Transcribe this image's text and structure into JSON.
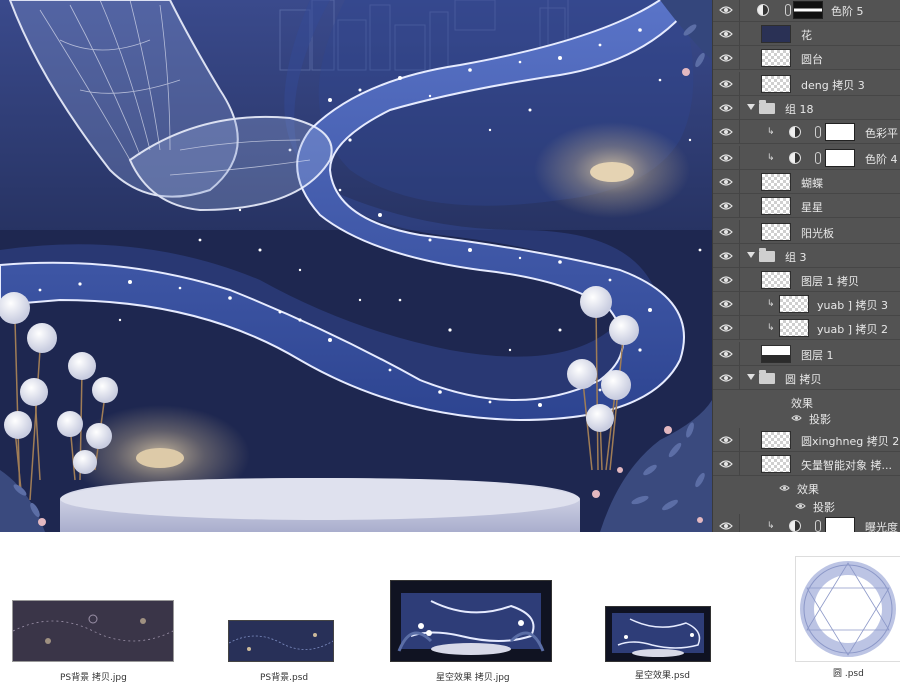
{
  "layers": [
    {
      "name": "色阶 5",
      "kind": "adjust",
      "visible": true
    },
    {
      "name": "花",
      "kind": "layer",
      "thumb": "dark",
      "visible": true
    },
    {
      "name": "圆台",
      "kind": "layer",
      "visible": true
    },
    {
      "name": "deng 拷贝 3",
      "kind": "layer",
      "visible": true
    },
    {
      "name": "组 18",
      "kind": "group",
      "visible": true
    },
    {
      "name": "色彩平",
      "kind": "adjust-clip",
      "visible": true
    },
    {
      "name": "色阶 4",
      "kind": "adjust-clip",
      "visible": true
    },
    {
      "name": "蝴蝶",
      "kind": "layer",
      "visible": true
    },
    {
      "name": "星星",
      "kind": "layer",
      "visible": true
    },
    {
      "name": "阳光板",
      "kind": "layer",
      "visible": true
    },
    {
      "name": "组 3",
      "kind": "group",
      "visible": true
    },
    {
      "name": "图层 1 拷贝",
      "kind": "layer",
      "visible": true
    },
    {
      "name": "yuab ] 拷贝 3",
      "kind": "layer-clip",
      "visible": true
    },
    {
      "name": "yuab ] 拷贝 2",
      "kind": "layer-clip",
      "visible": true
    },
    {
      "name": "图层 1",
      "kind": "layer",
      "thumb": "dark2",
      "visible": true
    },
    {
      "name": "圆 拷贝",
      "kind": "group",
      "visible": true
    },
    {
      "name": "效果",
      "kind": "effect-header",
      "visible": false
    },
    {
      "name": "投影",
      "kind": "effect",
      "visible": true
    },
    {
      "name": "圆xinghneg 拷贝 2",
      "kind": "layer",
      "visible": true
    },
    {
      "name": "矢量智能对象 拷...",
      "kind": "layer",
      "visible": true
    },
    {
      "name": "效果",
      "kind": "effect-header",
      "visible": true
    },
    {
      "name": "投影",
      "kind": "effect",
      "visible": true
    },
    {
      "name": "曝光度",
      "kind": "adjust-clip",
      "visible": true
    }
  ],
  "files": [
    {
      "name": "PS背景 拷贝.jpg",
      "icon": "background-jpg-thumbnail"
    },
    {
      "name": "PS背景.psd",
      "icon": "background-psd-thumbnail"
    },
    {
      "name": "星空效果 拷贝.jpg",
      "icon": "starry-effect-jpg-thumbnail"
    },
    {
      "name": "星空效果.psd",
      "icon": "starry-effect-psd-thumbnail"
    },
    {
      "name": "圆 .psd",
      "icon": "circle-psd-thumbnail"
    }
  ],
  "colors": {
    "panel": "#535353",
    "canvas_bg": "#24305a",
    "ribbon": "#3b55a6",
    "platform": "#c8cbdf"
  }
}
